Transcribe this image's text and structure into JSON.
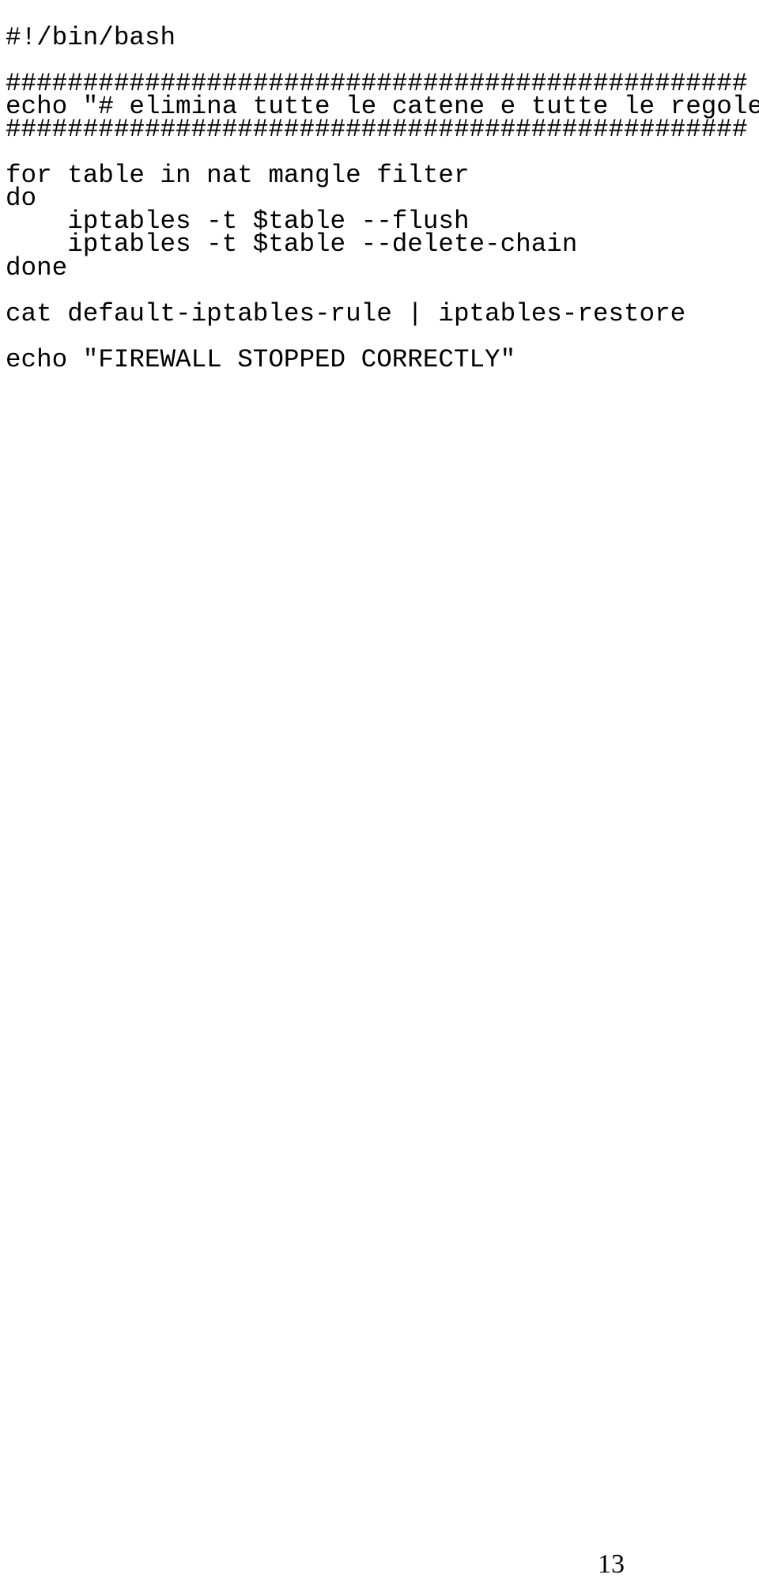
{
  "document": {
    "kind": "shell-script-listing",
    "page_background": "#ffffff",
    "text_color": "#000000",
    "page_number": "13"
  },
  "code": {
    "language": "bash",
    "lines": [
      "#!/bin/bash",
      "",
      "################################################",
      "echo \"# elimina tutte le catene e tutte le regole #\"",
      "################################################",
      "",
      "for table in nat mangle filter",
      "do",
      "    iptables -t $table --flush",
      "    iptables -t $table --delete-chain",
      "done",
      "",
      "cat default-iptables-rule | iptables-restore",
      "",
      "echo \"FIREWALL STOPPED CORRECTLY\""
    ]
  }
}
